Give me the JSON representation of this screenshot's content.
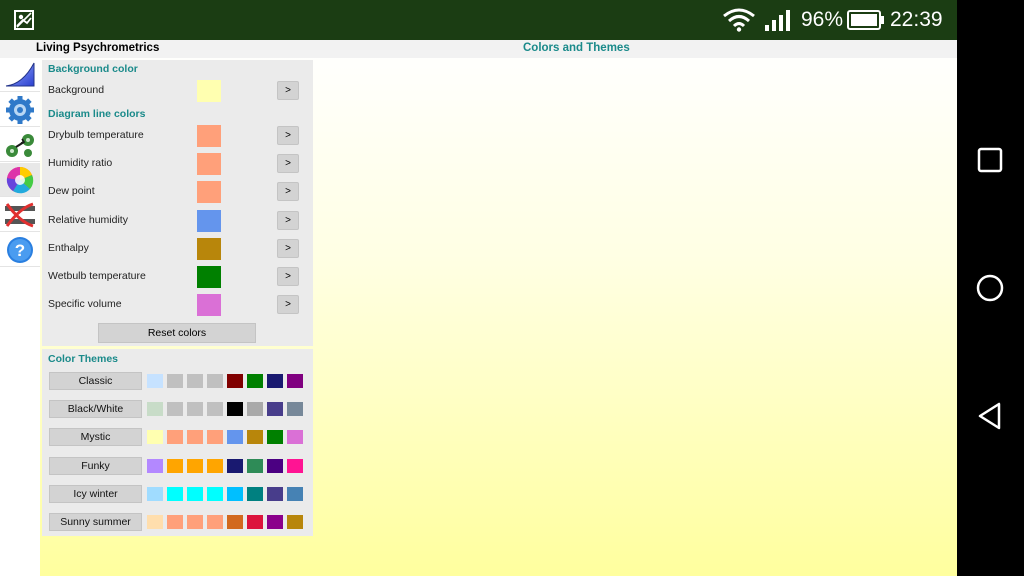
{
  "status_bar": {
    "battery_percent": "96%",
    "time": "22:39",
    "icons": [
      "gallery-icon",
      "wifi-icon",
      "signal-icon",
      "battery-icon"
    ]
  },
  "header": {
    "app_title": "Living Psychrometrics",
    "page_title": "Colors and Themes"
  },
  "sidebar": {
    "items": [
      {
        "icon": "chart-icon"
      },
      {
        "icon": "gear-icon"
      },
      {
        "icon": "process-icon"
      },
      {
        "icon": "color-wheel-icon",
        "active": true
      },
      {
        "icon": "crossed-lines-icon"
      },
      {
        "icon": "help-icon"
      }
    ]
  },
  "background_section": {
    "title": "Background color",
    "rows": [
      {
        "label": "Background",
        "color": "#ffffb0",
        "button": ">"
      }
    ]
  },
  "line_colors_section": {
    "title": "Diagram line colors",
    "rows": [
      {
        "label": "Drybulb temperature",
        "color": "#ffa07a",
        "button": ">"
      },
      {
        "label": "Humidity ratio",
        "color": "#ffa07a",
        "button": ">"
      },
      {
        "label": "Dew point",
        "color": "#ffa07a",
        "button": ">"
      },
      {
        "label": "Relative humidity",
        "color": "#6495ed",
        "button": ">"
      },
      {
        "label": "Enthalpy",
        "color": "#b8860b",
        "button": ">"
      },
      {
        "label": "Wetbulb temperature",
        "color": "#008000",
        "button": ">"
      },
      {
        "label": "Specific volume",
        "color": "#da70d6",
        "button": ">"
      }
    ],
    "reset_label": "Reset colors"
  },
  "themes_section": {
    "title": "Color Themes",
    "themes": [
      {
        "name": "Classic",
        "colors": [
          "#c6e2ff",
          "#c0c0c0",
          "#c0c0c0",
          "#c0c0c0",
          "#800000",
          "#008000",
          "#191970",
          "#800080"
        ]
      },
      {
        "name": "Black/White",
        "colors": [
          "#c8dcc8",
          "#c0c0c0",
          "#c0c0c0",
          "#c0c0c0",
          "#000000",
          "#a9a9a9",
          "#483d8b",
          "#778899"
        ]
      },
      {
        "name": "Mystic",
        "colors": [
          "#ffffb0",
          "#ffa07a",
          "#ffa07a",
          "#ffa07a",
          "#6495ed",
          "#b8860b",
          "#008000",
          "#da70d6"
        ]
      },
      {
        "name": "Funky",
        "colors": [
          "#b388ff",
          "#ffa500",
          "#ffa500",
          "#ffa500",
          "#191970",
          "#2e8b57",
          "#4b0082",
          "#ff1493"
        ]
      },
      {
        "name": "Icy winter",
        "colors": [
          "#a0dcff",
          "#00ffff",
          "#00ffff",
          "#00ffff",
          "#00bfff",
          "#008080",
          "#483d8b",
          "#4682b4"
        ]
      },
      {
        "name": "Sunny summer",
        "colors": [
          "#ffdead",
          "#ffa07a",
          "#ffa07a",
          "#ffa07a",
          "#d2691e",
          "#dc143c",
          "#8b008b",
          "#b8860b"
        ]
      }
    ]
  },
  "nav_bar": {
    "icons": [
      "recents-square-icon",
      "home-circle-icon",
      "back-triangle-icon"
    ]
  }
}
